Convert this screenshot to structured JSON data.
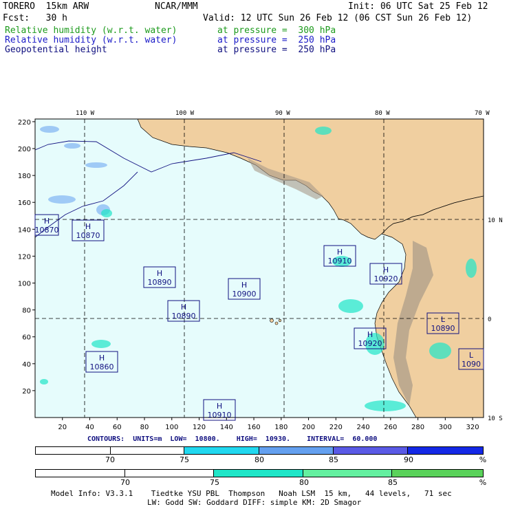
{
  "header": {
    "line1_left": "TORERO  15km ARW",
    "line1_mid": "NCAR/MMM",
    "line1_right": "Init: 06 UTC Sat 25 Feb 12",
    "line2_left": "Fcst:   30 h",
    "line2_right": "Valid: 12 UTC Sun 26 Feb 12 (06 CST Sun 26 Feb 12)",
    "fields": [
      {
        "name": "Relative humidity (w.r.t. water)",
        "level": "at pressure =  300 hPa",
        "color": "#1c9a1c"
      },
      {
        "name": "Relative humidity (w.r.t. water)",
        "level": "at pressure =  250 hPa",
        "color": "#1a1ac8"
      },
      {
        "name": "Geopotential height",
        "level": "at pressure =  250 hPa",
        "color": "#101080"
      }
    ]
  },
  "map": {
    "lon_labels": [
      "110 W",
      "100 W",
      "90 W",
      "80 W",
      "70 W"
    ],
    "lat_labels": [
      "10 N",
      "0",
      "10 S"
    ],
    "x_ticks": [
      "20",
      "40",
      "60",
      "80",
      "100",
      "120",
      "140",
      "160",
      "180",
      "200",
      "220",
      "240",
      "260",
      "280",
      "300",
      "320"
    ],
    "y_ticks": [
      "220",
      "200",
      "180",
      "160",
      "140",
      "120",
      "100",
      "80",
      "60",
      "40",
      "20"
    ],
    "colors": {
      "ocean": "#e6fcfc",
      "land": "#f0cfa0",
      "grid": "#000000",
      "contour": "#101080"
    },
    "height_labels": [
      {
        "type": "H",
        "value": "10870"
      },
      {
        "type": "H",
        "value": "10870"
      },
      {
        "type": "H",
        "value": "10890"
      },
      {
        "type": "H",
        "value": "10890"
      },
      {
        "type": "H",
        "value": "10900"
      },
      {
        "type": "H",
        "value": "10910"
      },
      {
        "type": "H",
        "value": "10920"
      },
      {
        "type": "H",
        "value": "10920"
      },
      {
        "type": "L",
        "value": "10890"
      },
      {
        "type": "H",
        "value": "10860"
      },
      {
        "type": "H",
        "value": "10910"
      },
      {
        "type": "L",
        "value": "1090"
      }
    ]
  },
  "contours": {
    "text": "CONTOURS:  UNITS=m  LOW=  10800.    HIGH=  10930.    INTERVAL=  60.000"
  },
  "colorbar_250": {
    "segments": [
      {
        "color": "#ffffff"
      },
      {
        "color": "#ffffff"
      },
      {
        "color": "#21d8f0"
      },
      {
        "color": "#64a0f0"
      },
      {
        "color": "#5a5ae6"
      },
      {
        "color": "#1428e6"
      }
    ],
    "labels": [
      "70",
      "75",
      "80",
      "85",
      "90"
    ],
    "unit": "%"
  },
  "colorbar_300": {
    "segments": [
      {
        "color": "#ffffff"
      },
      {
        "color": "#ffffff"
      },
      {
        "color": "#20e6c8"
      },
      {
        "color": "#64f0a0"
      },
      {
        "color": "#5ad25a"
      }
    ],
    "labels": [
      "70",
      "75",
      "80",
      "85"
    ],
    "unit": "%"
  },
  "footer": {
    "line1": "Model Info: V3.3.1    Tiedtke YSU PBL  Thompson   Noah LSM  15 km,   44 levels,   71 sec",
    "line2": "LW: Godd SW: Goddard DIFF: simple KM: 2D Smagor"
  }
}
